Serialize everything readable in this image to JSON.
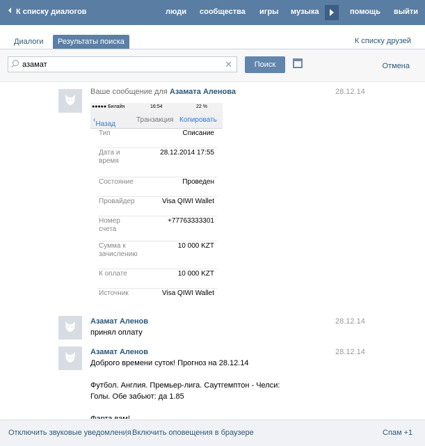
{
  "topbar": {
    "back_label": "К списку диалогов",
    "nav": [
      "люди",
      "сообщества",
      "игры",
      "музыка",
      "помощь",
      "выйти"
    ]
  },
  "tabs": {
    "dialogs": "Диалоги",
    "results": "Результаты поиска",
    "friends_link": "К списку друзей"
  },
  "search": {
    "value": "азамат",
    "button": "Поиск",
    "cancel": "Отмена"
  },
  "messages": [
    {
      "meta_prefix": "Ваше сообщение для",
      "meta_name": "Азамата Аленова",
      "date": "28.12.14",
      "screenshot": {
        "carrier": "●●●●● Билайн",
        "time": "16:54",
        "battery": "22 %",
        "back": "Назад",
        "title": "Транзакция",
        "action": "Копировать",
        "rows": [
          {
            "k": "Тип",
            "v": "Списание"
          },
          {
            "k": "Дата и\nвремя",
            "v": "28.12.2014 17:55"
          },
          {
            "k": "Состояние",
            "v": "Проведен"
          },
          {
            "k": "Провайдер",
            "v": "Visa QIWI Wallet"
          },
          {
            "k": "Номер\nсчета",
            "v": "+77763333301"
          },
          {
            "k": "Сумма к\nзачислению",
            "v": "10 000 KZT"
          },
          {
            "k": "К оплате",
            "v": "10 000 KZT"
          },
          {
            "k": "Источник",
            "v": "Visa QIWI Wallet"
          }
        ]
      }
    },
    {
      "author": "Азамат Аленов",
      "date": "28.12.14",
      "text": "принял оплату"
    },
    {
      "author": "Азамат Аленов",
      "date": "28.12.14",
      "text": "Доброго времени суток! Прогноз на 28.12.14\n\nФутбол. Англия. Премьер-лига. Саутгемптон - Челси:\nГолы. Обе забьют: да 1.85\n\nФарта вам!"
    }
  ],
  "footer": {
    "sound": "Отключить звуковые уведомления",
    "separator": "|",
    "browser": "Включить оповещения в браузере",
    "spam": "Спам +1"
  }
}
